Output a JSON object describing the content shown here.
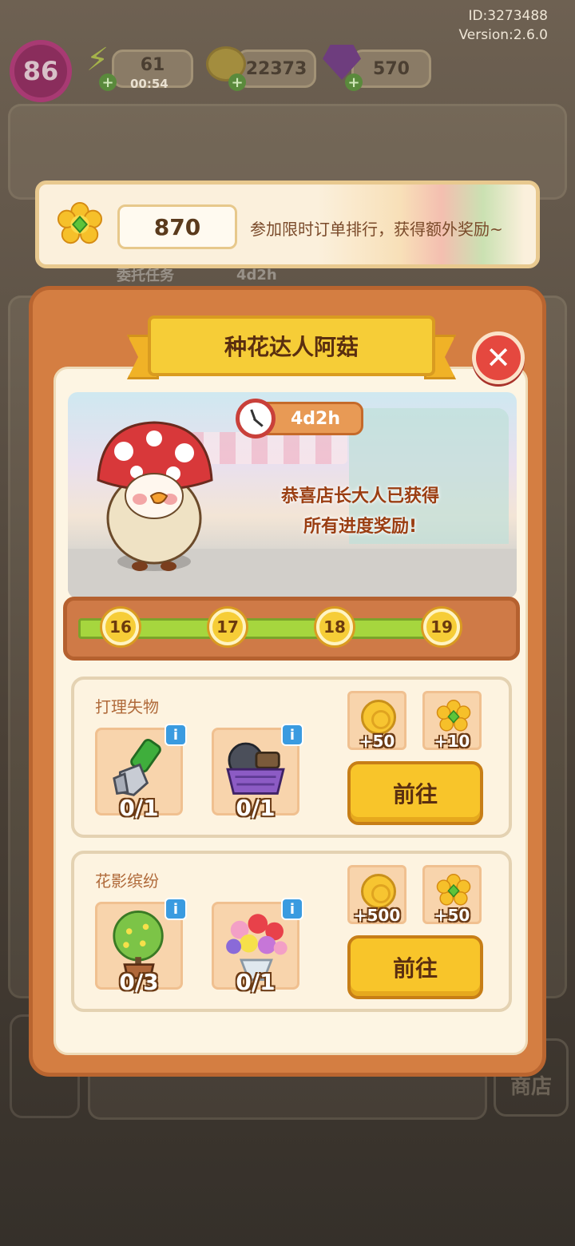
{
  "meta": {
    "id_text": "ID:3273488",
    "version_text": "Version:2.6.0"
  },
  "hud": {
    "level": "86",
    "energy": "61",
    "energy_timer": "00:54",
    "coins": "22373",
    "gems": "570"
  },
  "background": {
    "tab_1": "委托任务",
    "tab_2": "4d2h",
    "shop_label": "商店"
  },
  "banner": {
    "flower_count": "870",
    "text": "参加限时订单排行，获得额外奖励~"
  },
  "modal": {
    "title": "种花达人阿菇",
    "timer": "4d2h",
    "message_line1": "恭喜店长大人已获得",
    "message_line2": "所有进度奖励!",
    "progress_nodes": [
      "16",
      "17",
      "18",
      "19"
    ]
  },
  "tasks": [
    {
      "title": "打理失物",
      "items": [
        {
          "icon": "wrench-icon",
          "count": "0/1"
        },
        {
          "icon": "tool-basket-icon",
          "count": "0/1"
        }
      ],
      "rewards": [
        {
          "icon": "coin-icon",
          "label": "+50"
        },
        {
          "icon": "flower-gem-icon",
          "label": "+10"
        }
      ],
      "button": "前往"
    },
    {
      "title": "花影缤纷",
      "items": [
        {
          "icon": "potted-tree-icon",
          "count": "0/3"
        },
        {
          "icon": "flower-bouquet-icon",
          "count": "0/1"
        }
      ],
      "rewards": [
        {
          "icon": "coin-icon",
          "label": "+500"
        },
        {
          "icon": "flower-gem-icon",
          "label": "+50"
        }
      ],
      "button": "前往"
    }
  ],
  "colors": {
    "modal_orange": "#d47e42",
    "button_yellow": "#f8c52a",
    "close_red": "#e5483f",
    "progress_green": "#a6d63e"
  }
}
